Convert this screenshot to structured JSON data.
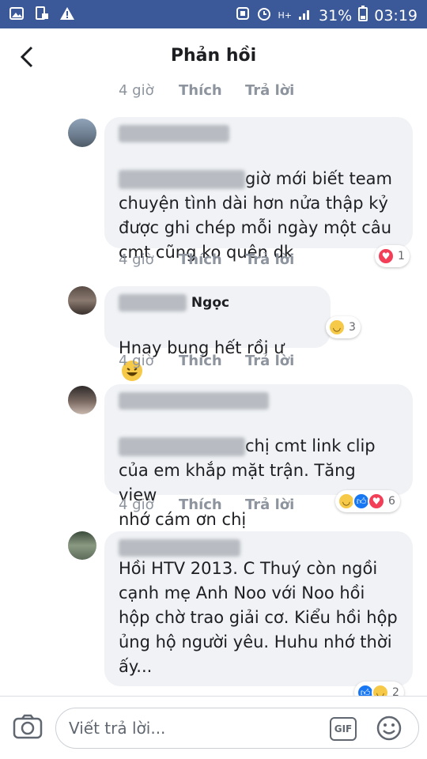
{
  "status_bar": {
    "battery": "31%",
    "time": "03:19",
    "network": "H+"
  },
  "header": {
    "title": "Phản hồi"
  },
  "top_meta": {
    "time": "4 giờ",
    "like": "Thích",
    "reply": "Trả lời"
  },
  "comments": [
    {
      "text": "giờ mới biết team\nchuyện tình dài hơn nửa thập kỷ\nđược ghi chép mỗi ngày một câu\ncmt cũng ko quên dk",
      "time": "4 giờ",
      "like": "Thích",
      "reply": "Trả lời",
      "reaction_count": "1"
    },
    {
      "name_partial": "Ngọc",
      "text": "Hnay bung hết rồi ư",
      "time": "4 giờ",
      "like": "Thích",
      "reply": "Trả lời",
      "reaction_count": "3"
    },
    {
      "text": "chị cmt link clip\ncủa em khắp mặt trận. Tăng view\nnhớ cám ơn chị",
      "time": "4 giờ",
      "like": "Thích",
      "reply": "Trả lời",
      "reaction_count": "6"
    },
    {
      "text": "Hồi HTV 2013. C Thuý còn ngồi\ncạnh mẹ Anh Noo với Noo hồi\nhộp chờ trao giải cơ. Kiểu hồi hộp\nủng hộ người yêu. Huhu nhớ thời\nấy...",
      "reaction_count": "2"
    }
  ],
  "composer": {
    "placeholder": "Viết trả lời...",
    "gif_label": "GIF"
  },
  "colors": {
    "status_bar": "#3b5998",
    "bubble": "#f0f2f5",
    "meta": "#8d949e",
    "like_blue": "#1877f2",
    "love_red": "#f33e58",
    "haha_yellow": "#f7c948"
  }
}
